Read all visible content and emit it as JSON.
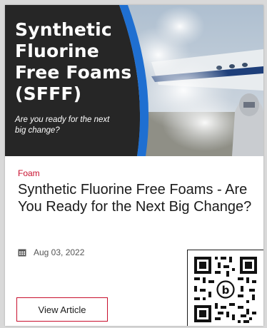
{
  "hero": {
    "title": "Synthetic\nFluorine\nFree Foams\n(SFFF)",
    "subtitle": "Are you ready for the next big change?",
    "panel_color": "#262626",
    "accent_color": "#1f6fd1"
  },
  "article": {
    "category": "Foam",
    "title": "Synthetic Fluorine Free Foams - Are You Ready for the Next Big Change?",
    "date": "Aug 03, 2022",
    "button_label": "View Article"
  },
  "qr_code": {
    "icon": "qr-code",
    "center_logo_letter": "b"
  },
  "colors": {
    "category": "#c8102e",
    "button_border": "#c8102e",
    "title": "#1b1b1b"
  }
}
